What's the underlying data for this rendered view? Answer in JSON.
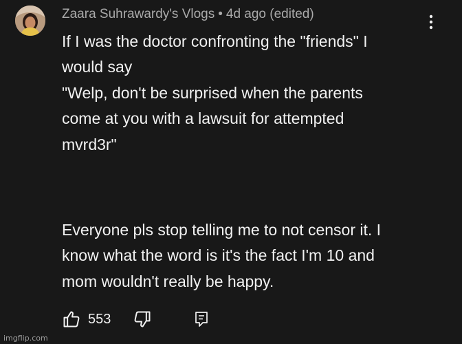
{
  "comment": {
    "author": "Zaara Suhrawardy's Vlogs",
    "separator": "•",
    "time": "4d ago (edited)",
    "paragraph1": [
      "If I was the doctor confronting the \"friends\" I",
      "would say",
      "\"Welp, don't be surprised when the parents",
      "come at you with a lawsuit for attempted",
      "mvrd3r\""
    ],
    "paragraph2": [
      "Everyone pls stop telling me to not censor it. I",
      "know what the word is it's the fact I'm 10 and",
      "mom wouldn't really be happy."
    ],
    "like_count": "553"
  },
  "icons": {
    "menu": "more-vertical-icon",
    "like": "thumbs-up-icon",
    "dislike": "thumbs-down-icon",
    "reply": "reply-icon"
  },
  "watermark": "imgflip.com"
}
